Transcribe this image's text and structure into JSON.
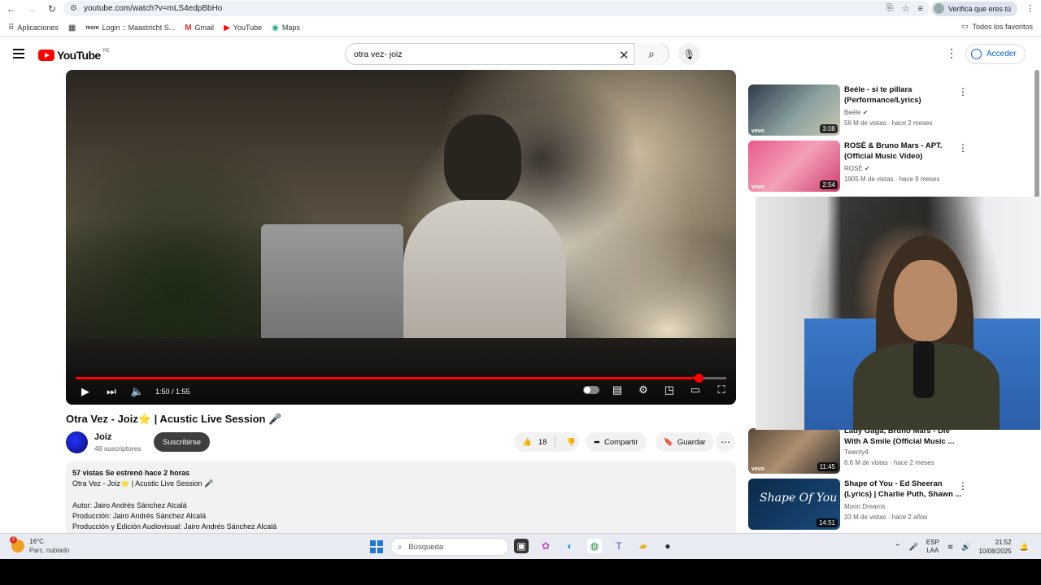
{
  "browser": {
    "url": "youtube.com/watch?v=mLS4edpBbHo",
    "profile_chip": "Verifica que eres tú",
    "bookmarks": [
      {
        "label": "Aplicaciones",
        "icon": "apps-grid-icon"
      },
      {
        "label": "Login :: Maastricht S...",
        "icon": "msm-icon"
      },
      {
        "label": "Gmail",
        "icon": "gmail-icon"
      },
      {
        "label": "YouTube",
        "icon": "youtube-icon"
      },
      {
        "label": "Maps",
        "icon": "maps-icon"
      }
    ],
    "all_bookmarks": "Todos los favoritos"
  },
  "header": {
    "logo_text": "YouTube",
    "country_code": "PE",
    "search_value": "otra vez- joiz",
    "sign_in": "Acceder"
  },
  "player": {
    "time": "1:50 / 1:55",
    "progress": 0.957
  },
  "video": {
    "title": "Otra Vez - Joiz⭐ | Acustic Live Session 🎤",
    "channel": "Joiz",
    "subscribers": "48 suscriptores",
    "subscribe": "Suscribirse",
    "likes": "18",
    "share": "Compartir",
    "save": "Guardar"
  },
  "description": {
    "stats": "57 vistas  Se estrenó hace 2 horas",
    "line1": "Otra Vez - Joiz⭐ | Acustic Live Session 🎤",
    "line2": "Autor: Jairo Andrés Sánchez Alcalá",
    "line3": "Producción: Jairo Andrés Sánchez Alcalá",
    "line4": "Producción y Edición Audiovisual: Jairo Andrés Sánchez Alcalá"
  },
  "recommendations": [
    {
      "title": "Beéle - si te pillara (Performance/Lyrics)",
      "channel": "Beéle",
      "meta": "56 M de vistas · hace 2 meses",
      "duration": "3:08",
      "vevo": "vevo"
    },
    {
      "title": "ROSÉ & Bruno Mars - APT. (Official Music Video)",
      "channel": "ROSÉ",
      "meta": "1905 M de vistas · hace 9 meses",
      "duration": "2:54",
      "vevo": "vevo"
    },
    {
      "title": "Lady Gaga, Bruno Mars - Die With A Smile (Official Music ...",
      "channel": "Twenty4",
      "meta": "6.6 M de vistas · hace 2 meses",
      "duration": "11:45",
      "vevo": "vevo"
    },
    {
      "title": "Shape of You - Ed Sheeran (Lyrics) | Charlie Puth, Shawn ...",
      "channel": "Moon Dreams",
      "meta": "33 M de vistas · hace 2 años",
      "duration": "14:51",
      "thumb_text": "Shape Of You"
    }
  ],
  "taskbar": {
    "weather_temp": "16°C",
    "weather_desc": "Parc. nublado",
    "weather_badge": "2",
    "search_placeholder": "Búsqueda",
    "lang_top": "ESP",
    "lang_bottom": "LAA",
    "time": "21:52",
    "date": "10/08/2025"
  }
}
